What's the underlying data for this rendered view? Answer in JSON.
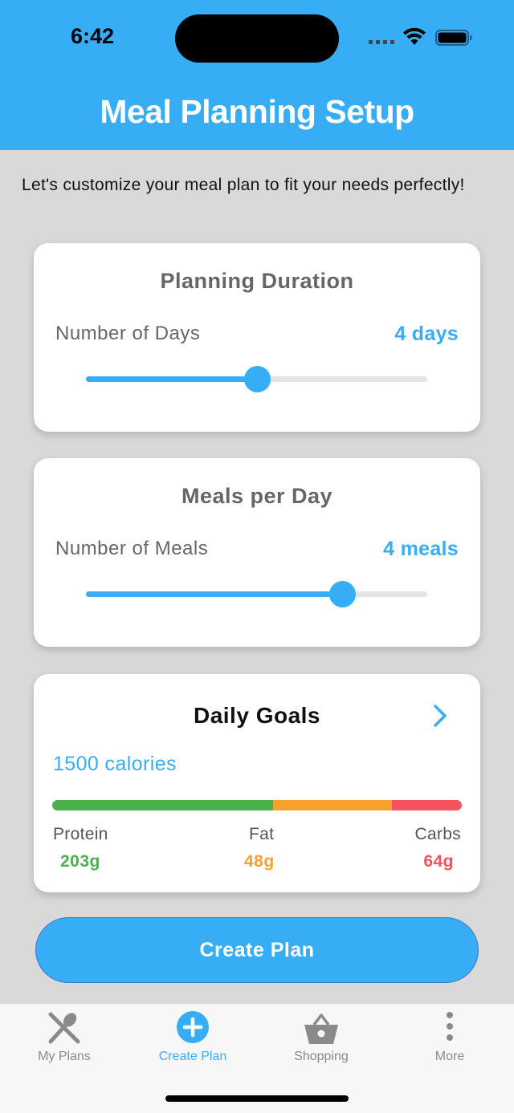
{
  "status_bar": {
    "time": "6:42"
  },
  "header": {
    "title": "Meal Planning Setup"
  },
  "intro_text": "Let's customize your meal plan to fit your needs perfectly!",
  "duration_card": {
    "title": "Planning Duration",
    "label": "Number of Days",
    "value": "4 days",
    "slider_fraction": 0.5
  },
  "meals_card": {
    "title": "Meals per Day",
    "label": "Number of Meals",
    "value": "4 meals",
    "slider_fraction": 0.75
  },
  "goals_card": {
    "title": "Daily Goals",
    "calories": "1500 calories",
    "macros": [
      {
        "name": "Protein",
        "value": "203g",
        "fraction": 0.54,
        "color": "#4caf50"
      },
      {
        "name": "Fat",
        "value": "48g",
        "fraction": 0.29,
        "color": "#f7a22e"
      },
      {
        "name": "Carbs",
        "value": "64g",
        "fraction": 0.17,
        "color": "#f5545e"
      }
    ]
  },
  "create_button": {
    "label": "Create Plan"
  },
  "tabbar": {
    "tabs": [
      {
        "label": "My Plans",
        "icon": "utensils-icon",
        "active": false
      },
      {
        "label": "Create Plan",
        "icon": "plus-circle-icon",
        "active": true
      },
      {
        "label": "Shopping",
        "icon": "basket-icon",
        "active": false
      },
      {
        "label": "More",
        "icon": "more-vertical-icon",
        "active": false
      }
    ]
  },
  "colors": {
    "accent": "#37adf6",
    "background": "#d9d9d9",
    "card": "#ffffff",
    "inactive_tab": "#8a8a8a"
  }
}
